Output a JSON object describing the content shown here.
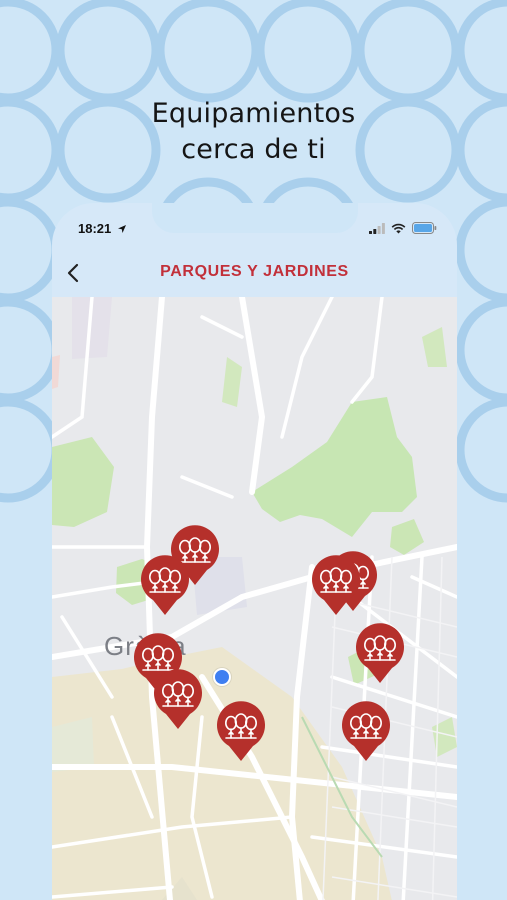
{
  "headline": {
    "line1": "Equipamientos",
    "line2": "cerca de ti"
  },
  "status_bar": {
    "time": "18:21",
    "icons": [
      "location-arrow-icon",
      "signal-icon",
      "wifi-icon",
      "battery-icon"
    ]
  },
  "header": {
    "title": "PARQUES Y JARDINES",
    "back_icon": "chevron-left-icon"
  },
  "map": {
    "place_label": "Gràcia",
    "pin_icon": "trees-icon",
    "pin_count": 10
  },
  "colors": {
    "background": "#cfe6f7",
    "accent": "#c2303a",
    "pin": "#b5302b",
    "location_dot": "#3f7ff1",
    "park_green": "#c7e6b3"
  }
}
